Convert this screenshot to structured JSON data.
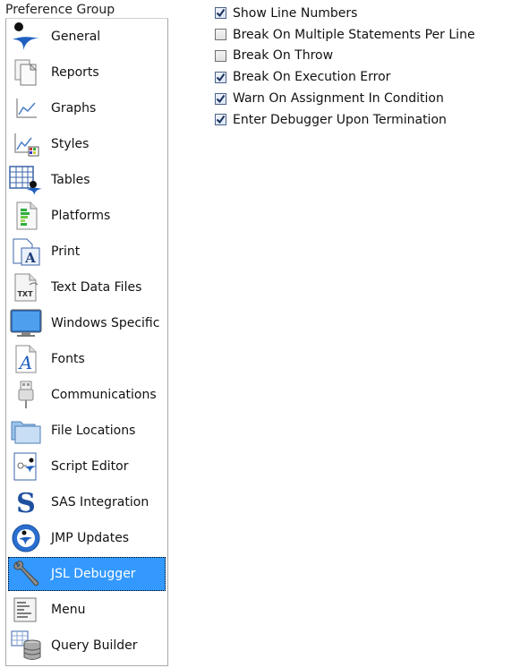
{
  "header": {
    "group_label": "Preference Group"
  },
  "groups": [
    {
      "label": "General",
      "icon": "general-icon"
    },
    {
      "label": "Reports",
      "icon": "reports-icon"
    },
    {
      "label": "Graphs",
      "icon": "graphs-icon"
    },
    {
      "label": "Styles",
      "icon": "styles-icon"
    },
    {
      "label": "Tables",
      "icon": "tables-icon"
    },
    {
      "label": "Platforms",
      "icon": "platforms-icon"
    },
    {
      "label": "Print",
      "icon": "print-icon"
    },
    {
      "label": "Text Data Files",
      "icon": "text-data-files-icon"
    },
    {
      "label": "Windows Specific",
      "icon": "windows-specific-icon"
    },
    {
      "label": "Fonts",
      "icon": "fonts-icon"
    },
    {
      "label": "Communications",
      "icon": "communications-icon"
    },
    {
      "label": "File Locations",
      "icon": "file-locations-icon"
    },
    {
      "label": "Script Editor",
      "icon": "script-editor-icon"
    },
    {
      "label": "SAS Integration",
      "icon": "sas-integration-icon"
    },
    {
      "label": "JMP Updates",
      "icon": "jmp-updates-icon"
    },
    {
      "label": "JSL Debugger",
      "icon": "jsl-debugger-icon",
      "selected": true
    },
    {
      "label": "Menu",
      "icon": "menu-icon"
    },
    {
      "label": "Query Builder",
      "icon": "query-builder-icon"
    }
  ],
  "options": [
    {
      "label": "Show Line Numbers",
      "checked": true
    },
    {
      "label": "Break On Multiple Statements Per Line",
      "checked": false
    },
    {
      "label": "Break On Throw",
      "checked": false
    },
    {
      "label": "Break On Execution Error",
      "checked": true
    },
    {
      "label": "Warn On Assignment In Condition",
      "checked": true
    },
    {
      "label": "Enter Debugger Upon Termination",
      "checked": true
    }
  ],
  "colors": {
    "selection": "#3399ff",
    "check": "#1a2f5a"
  },
  "icon_glyphs": {
    "fonts-icon": "A",
    "print-icon": "A",
    "text-data-files-icon": "TXT",
    "sas-integration-icon": "S"
  }
}
